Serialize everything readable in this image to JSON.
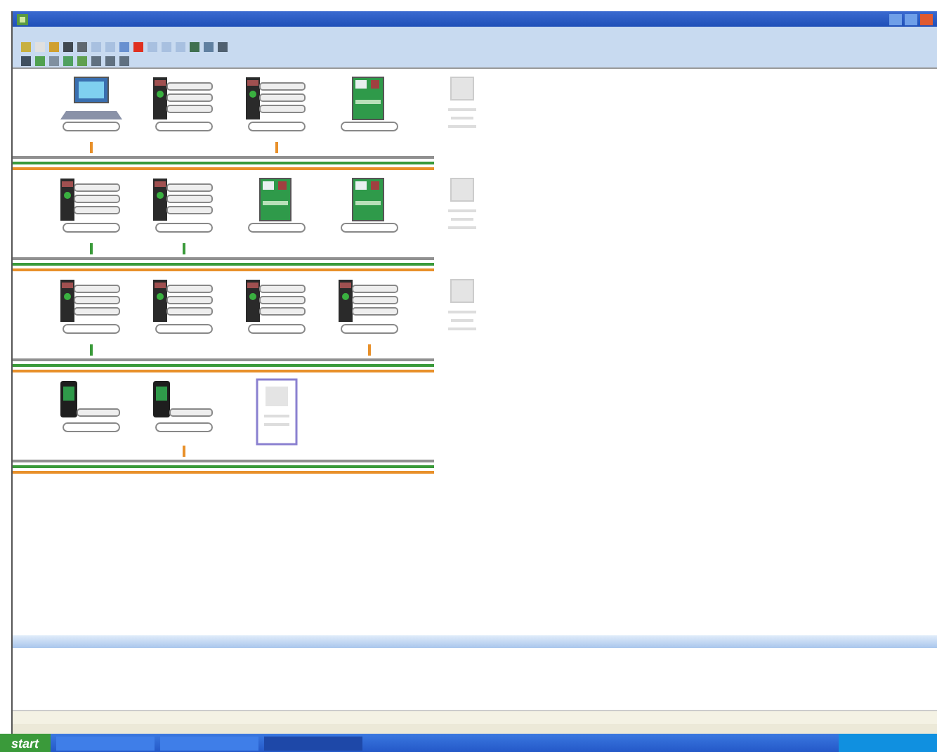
{
  "toolbars": [
    {
      "buttons": [
        {
          "color": "#c8b040"
        },
        {
          "color": "#e0e0e0"
        },
        {
          "color": "#d0a030"
        },
        {
          "color": "#404850"
        },
        {
          "color": "#606870"
        },
        {
          "color": "#a8c0e0"
        },
        {
          "color": "#a8c0e0"
        },
        {
          "color": "#6890d0"
        },
        {
          "color": "#e03020"
        },
        {
          "color": "#a8c0e0"
        },
        {
          "color": "#a8c0e0"
        },
        {
          "color": "#a8c0e0"
        },
        {
          "color": "#407050"
        },
        {
          "color": "#6080a0"
        },
        {
          "color": "#506070"
        }
      ]
    },
    {
      "buttons": [
        {
          "color": "#405060"
        },
        {
          "color": "#50a050"
        },
        {
          "color": "#8090a0"
        },
        {
          "color": "#50a060"
        },
        {
          "color": "#60a050"
        },
        {
          "color": "#607080"
        },
        {
          "color": "#607080"
        },
        {
          "color": "#607080"
        }
      ]
    }
  ],
  "rows": [
    {
      "devices": [
        {
          "kind": "pc",
          "color": "#e8902a"
        },
        {
          "kind": "drive"
        },
        {
          "kind": "drive",
          "color": "#e8902a"
        },
        {
          "kind": "green"
        },
        {
          "kind": "empty"
        }
      ],
      "buses": [
        {
          "color": "#909090"
        },
        {
          "color": "#3a9a3a"
        },
        {
          "color": "#e8902a"
        }
      ]
    },
    {
      "devices": [
        {
          "kind": "drive",
          "color": "#3a9a3a"
        },
        {
          "kind": "drive",
          "color": "#3a9a3a"
        },
        {
          "kind": "green"
        },
        {
          "kind": "green"
        },
        {
          "kind": "empty"
        }
      ],
      "buses": [
        {
          "color": "#909090"
        },
        {
          "color": "#3a9a3a"
        },
        {
          "color": "#e8902a"
        }
      ]
    },
    {
      "devices": [
        {
          "kind": "drive",
          "color": "#3a9a3a"
        },
        {
          "kind": "drive"
        },
        {
          "kind": "drive"
        },
        {
          "kind": "drive",
          "color": "#e8902a"
        },
        {
          "kind": "empty"
        }
      ],
      "buses": [
        {
          "color": "#909090"
        },
        {
          "color": "#3a9a3a"
        },
        {
          "color": "#e8902a"
        }
      ]
    },
    {
      "devices": [
        {
          "kind": "compact"
        },
        {
          "kind": "compact",
          "color": "#e8902a"
        },
        {
          "kind": "slot"
        }
      ],
      "buses": [
        {
          "color": "#909090"
        },
        {
          "color": "#3a9a3a"
        },
        {
          "color": "#e8902a"
        }
      ]
    }
  ],
  "taskbar": {
    "start": "start",
    "tasks": [
      {
        "selected": false
      },
      {
        "selected": false
      },
      {
        "selected": true
      }
    ]
  }
}
